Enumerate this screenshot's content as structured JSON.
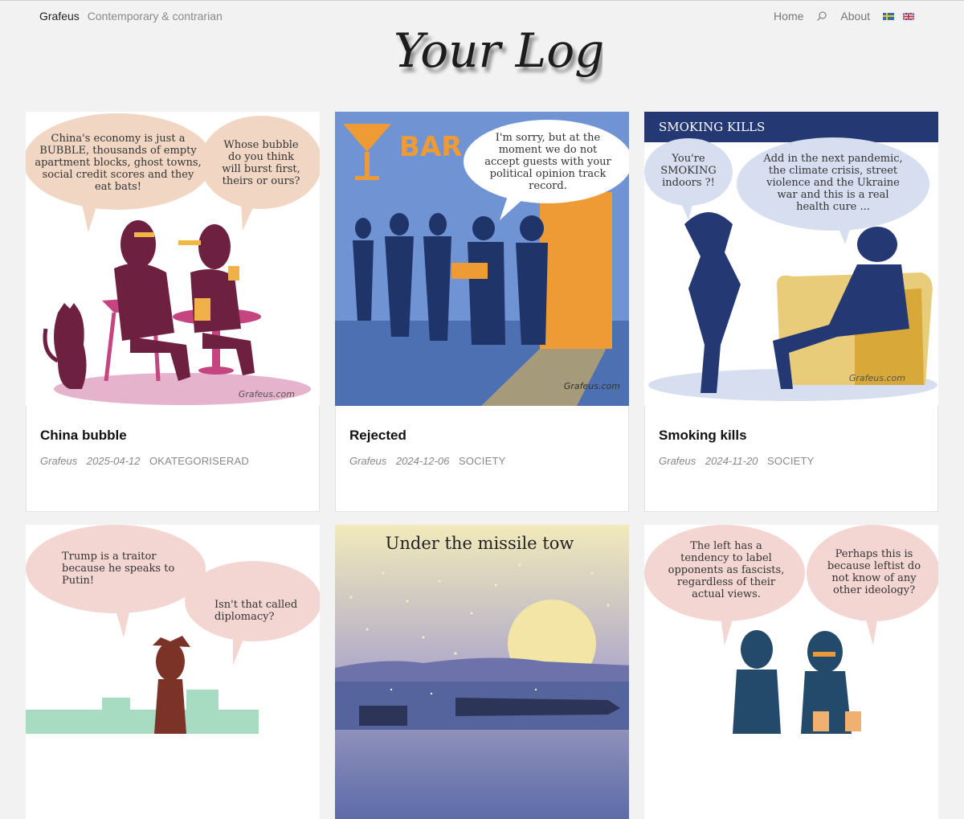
{
  "site": {
    "name": "Grafeus",
    "tagline": "Contemporary & contrarian",
    "logo_text": "Your Logo"
  },
  "nav": {
    "home": "Home",
    "about": "About",
    "languages": [
      "Swedish",
      "English"
    ]
  },
  "posts": [
    {
      "title": "China bubble",
      "author": "Grafeus",
      "date": "2025-04-12",
      "category": "OKATEGORISERAD",
      "bubbles": [
        "China's economy is just a BUBBLE, thousands of empty apartment blocks, ghost towns, social credit scores and they eat bats!",
        "Whose bubble do you think will burst first, theirs or ours?"
      ],
      "signature": "Grafeus.com"
    },
    {
      "title": "Rejected",
      "author": "Grafeus",
      "date": "2024-12-06",
      "category": "SOCIETY",
      "sign": "BAR",
      "bubbles": [
        "I'm sorry, but at the moment we do not accept guests with your political opinion track record."
      ],
      "signature": "Grafeus.com"
    },
    {
      "title": "Smoking kills",
      "author": "Grafeus",
      "date": "2024-11-20",
      "category": "SOCIETY",
      "banner": "SMOKING KILLS",
      "bubbles": [
        "You're SMOKING indoors ?!",
        "Add in the next pandemic, the climate crisis, street violence and the Ukraine war and this is a real health cure ..."
      ],
      "signature": "Grafeus.com"
    },
    {
      "bubbles": [
        "Trump is a traitor because he speaks to Putin!",
        "Isn't that called diplomacy?"
      ]
    },
    {
      "heading": "Under the missile tow"
    },
    {
      "bubbles": [
        "The left has a tendency to label opponents as fascists, regardless of their actual views.",
        "Perhaps this is because leftist do not know of any other ideology?"
      ]
    }
  ]
}
